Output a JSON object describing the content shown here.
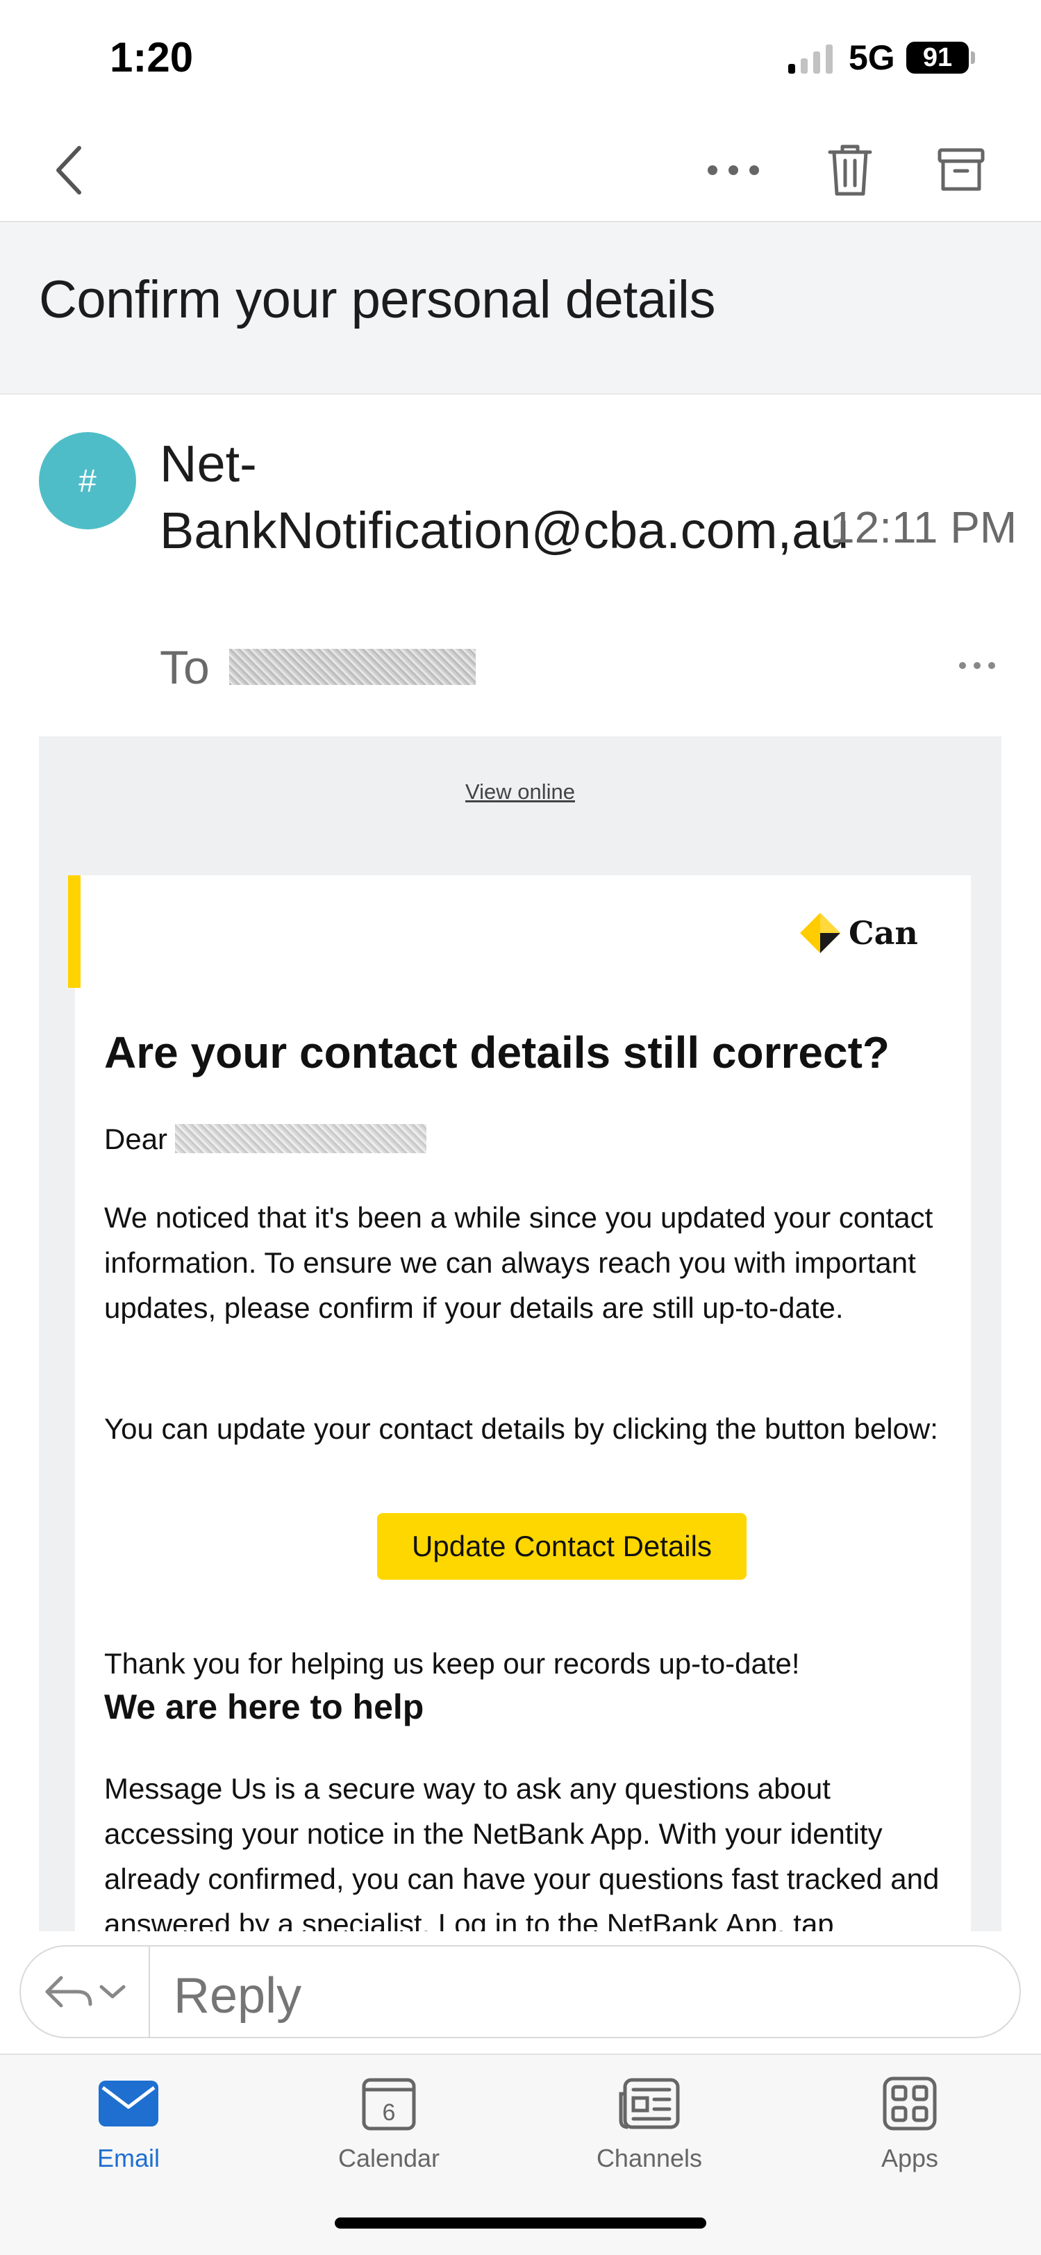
{
  "status_bar": {
    "time": "1:20",
    "network": "5G",
    "battery": "91"
  },
  "email": {
    "subject": "Confirm your personal details",
    "avatar_initial": "#",
    "sender": "Net-BankNotification@cba.com,au",
    "time": "12:11 PM",
    "to_label": "To"
  },
  "body": {
    "view_online": "View online",
    "logo_text": "Can",
    "heading": "Are your contact details still correct?",
    "salutation": "Dear",
    "para1": "We noticed that it's been a while since you updated your contact information. To ensure we can always reach you with important updates, please confirm if your details are still up-to-date.",
    "para2": "You can update your contact details by clicking the button below:",
    "cta_label": "Update Contact Details",
    "para3": "Thank you for helping us keep our records up-to-date!",
    "subheading": "We are here to help",
    "para4": "Message Us is a secure way to ask any questions about accessing your notice in the NetBank App. With your identity already confirmed, you can have your questions fast tracked and answered by a specialist. Log in to the NetBank App, tap"
  },
  "reply": {
    "placeholder": "Reply"
  },
  "tabs": [
    {
      "label": "Email"
    },
    {
      "label": "Calendar",
      "day": "6"
    },
    {
      "label": "Channels"
    },
    {
      "label": "Apps"
    }
  ],
  "colors": {
    "accent_blue": "#1e6fd0",
    "avatar_teal": "#4fbdc7",
    "cba_yellow": "#ffd700"
  }
}
